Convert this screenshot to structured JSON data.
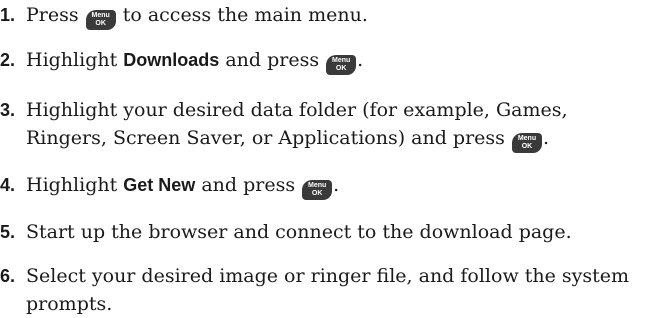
{
  "menu_key": {
    "icon": "menu-ok-key-icon",
    "line1": "Menu",
    "line2": "OK"
  },
  "steps": [
    {
      "number": "1.",
      "a": "Press",
      "b": "to access the main menu."
    },
    {
      "number": "2.",
      "a": "Highlight",
      "bold": "Downloads",
      "b": "and press",
      "end": "."
    },
    {
      "number": "3.",
      "line1": "Highlight your desired data folder (for example, Games,",
      "line2a": "Ringers, Screen Saver, or Applications) and press",
      "end": "."
    },
    {
      "number": "4.",
      "a": "Highlight",
      "bold": "Get New",
      "b": "and press",
      "end": "."
    },
    {
      "number": "5.",
      "text": "Start up the browser and connect to the download page."
    },
    {
      "number": "6.",
      "line1": "Select your desired image or ringer file, and follow the system",
      "line2": "prompts."
    }
  ]
}
